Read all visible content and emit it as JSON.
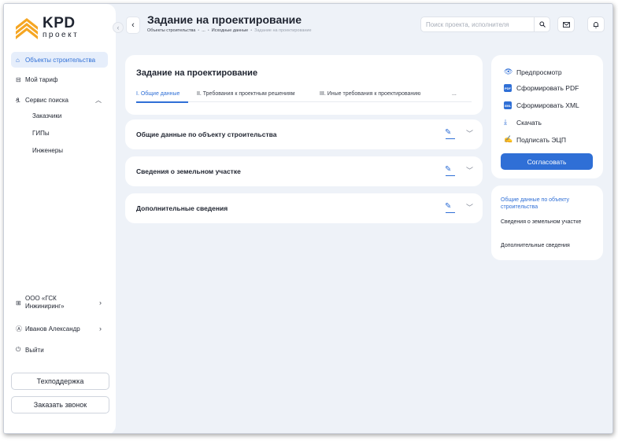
{
  "logo": {
    "name": "KPD",
    "sub": "проект"
  },
  "sidebar": {
    "nav": [
      {
        "label": "Объекты строительства",
        "icon": "home-icon"
      },
      {
        "label": "Мой тариф",
        "icon": "tariff-icon"
      },
      {
        "label": "Сервис поиска",
        "icon": "search-service-icon"
      }
    ],
    "sub": [
      "Заказчики",
      "ГИПы",
      "Инженеры"
    ],
    "org": "ООО «ГСК Инжиниринг»",
    "user": "Иванов Александр",
    "logout": "Выйти",
    "support": "Техподдержка",
    "callback": "Заказать звонок"
  },
  "header": {
    "title": "Задание на проектирование",
    "crumbs": [
      "Объекты строительства",
      "...",
      "Исходные данные",
      "Задание на проектирование"
    ],
    "search_placeholder": "Поиск проекта, исполнителя"
  },
  "main": {
    "title": "Задание на проектирование",
    "tabs": [
      "I. Общие данные",
      "II. Требования к проектным решениям",
      "III. Иные требования к проектированию",
      "..."
    ],
    "sections": [
      "Общие данные по объекту строительства",
      "Сведения о земельном участке",
      "Дополнительные сведения"
    ]
  },
  "actions": {
    "items": [
      "Предпросмотр",
      "Сформировать PDF",
      "Сформировать XML",
      "Скачать",
      "Подписать ЭЦП"
    ],
    "pdf_badge": "PDF",
    "xml_badge": "XML",
    "approve": "Согласовать"
  },
  "toc": [
    "Общие данные по объекту строительства",
    "Сведения о земельном участке",
    "Дополнительные сведения"
  ],
  "colors": {
    "accent": "#2f6fd6",
    "logo": "#f5a623",
    "background": "#eef2f8"
  }
}
